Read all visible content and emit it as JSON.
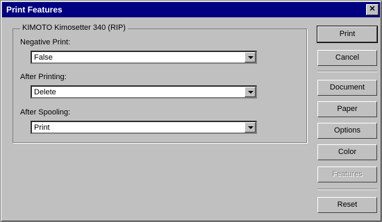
{
  "window": {
    "title": "Print Features"
  },
  "group": {
    "label": "KIMOTO Kimosetter 340 (RIP)"
  },
  "fields": [
    {
      "label": "Negative Print:",
      "value": "False"
    },
    {
      "label": "After Printing:",
      "value": "Delete"
    },
    {
      "label": "After Spooling:",
      "value": "Print"
    }
  ],
  "buttons": {
    "print": "Print",
    "cancel": "Cancel",
    "document": "Document",
    "paper": "Paper",
    "options": "Options",
    "color": "Color",
    "features": "Features",
    "reset": "Reset"
  },
  "icons": {
    "close": "close-icon",
    "dropdown": "chevron-down-icon"
  },
  "colors": {
    "titlebar": "#000080",
    "face": "#c0c0c0"
  }
}
